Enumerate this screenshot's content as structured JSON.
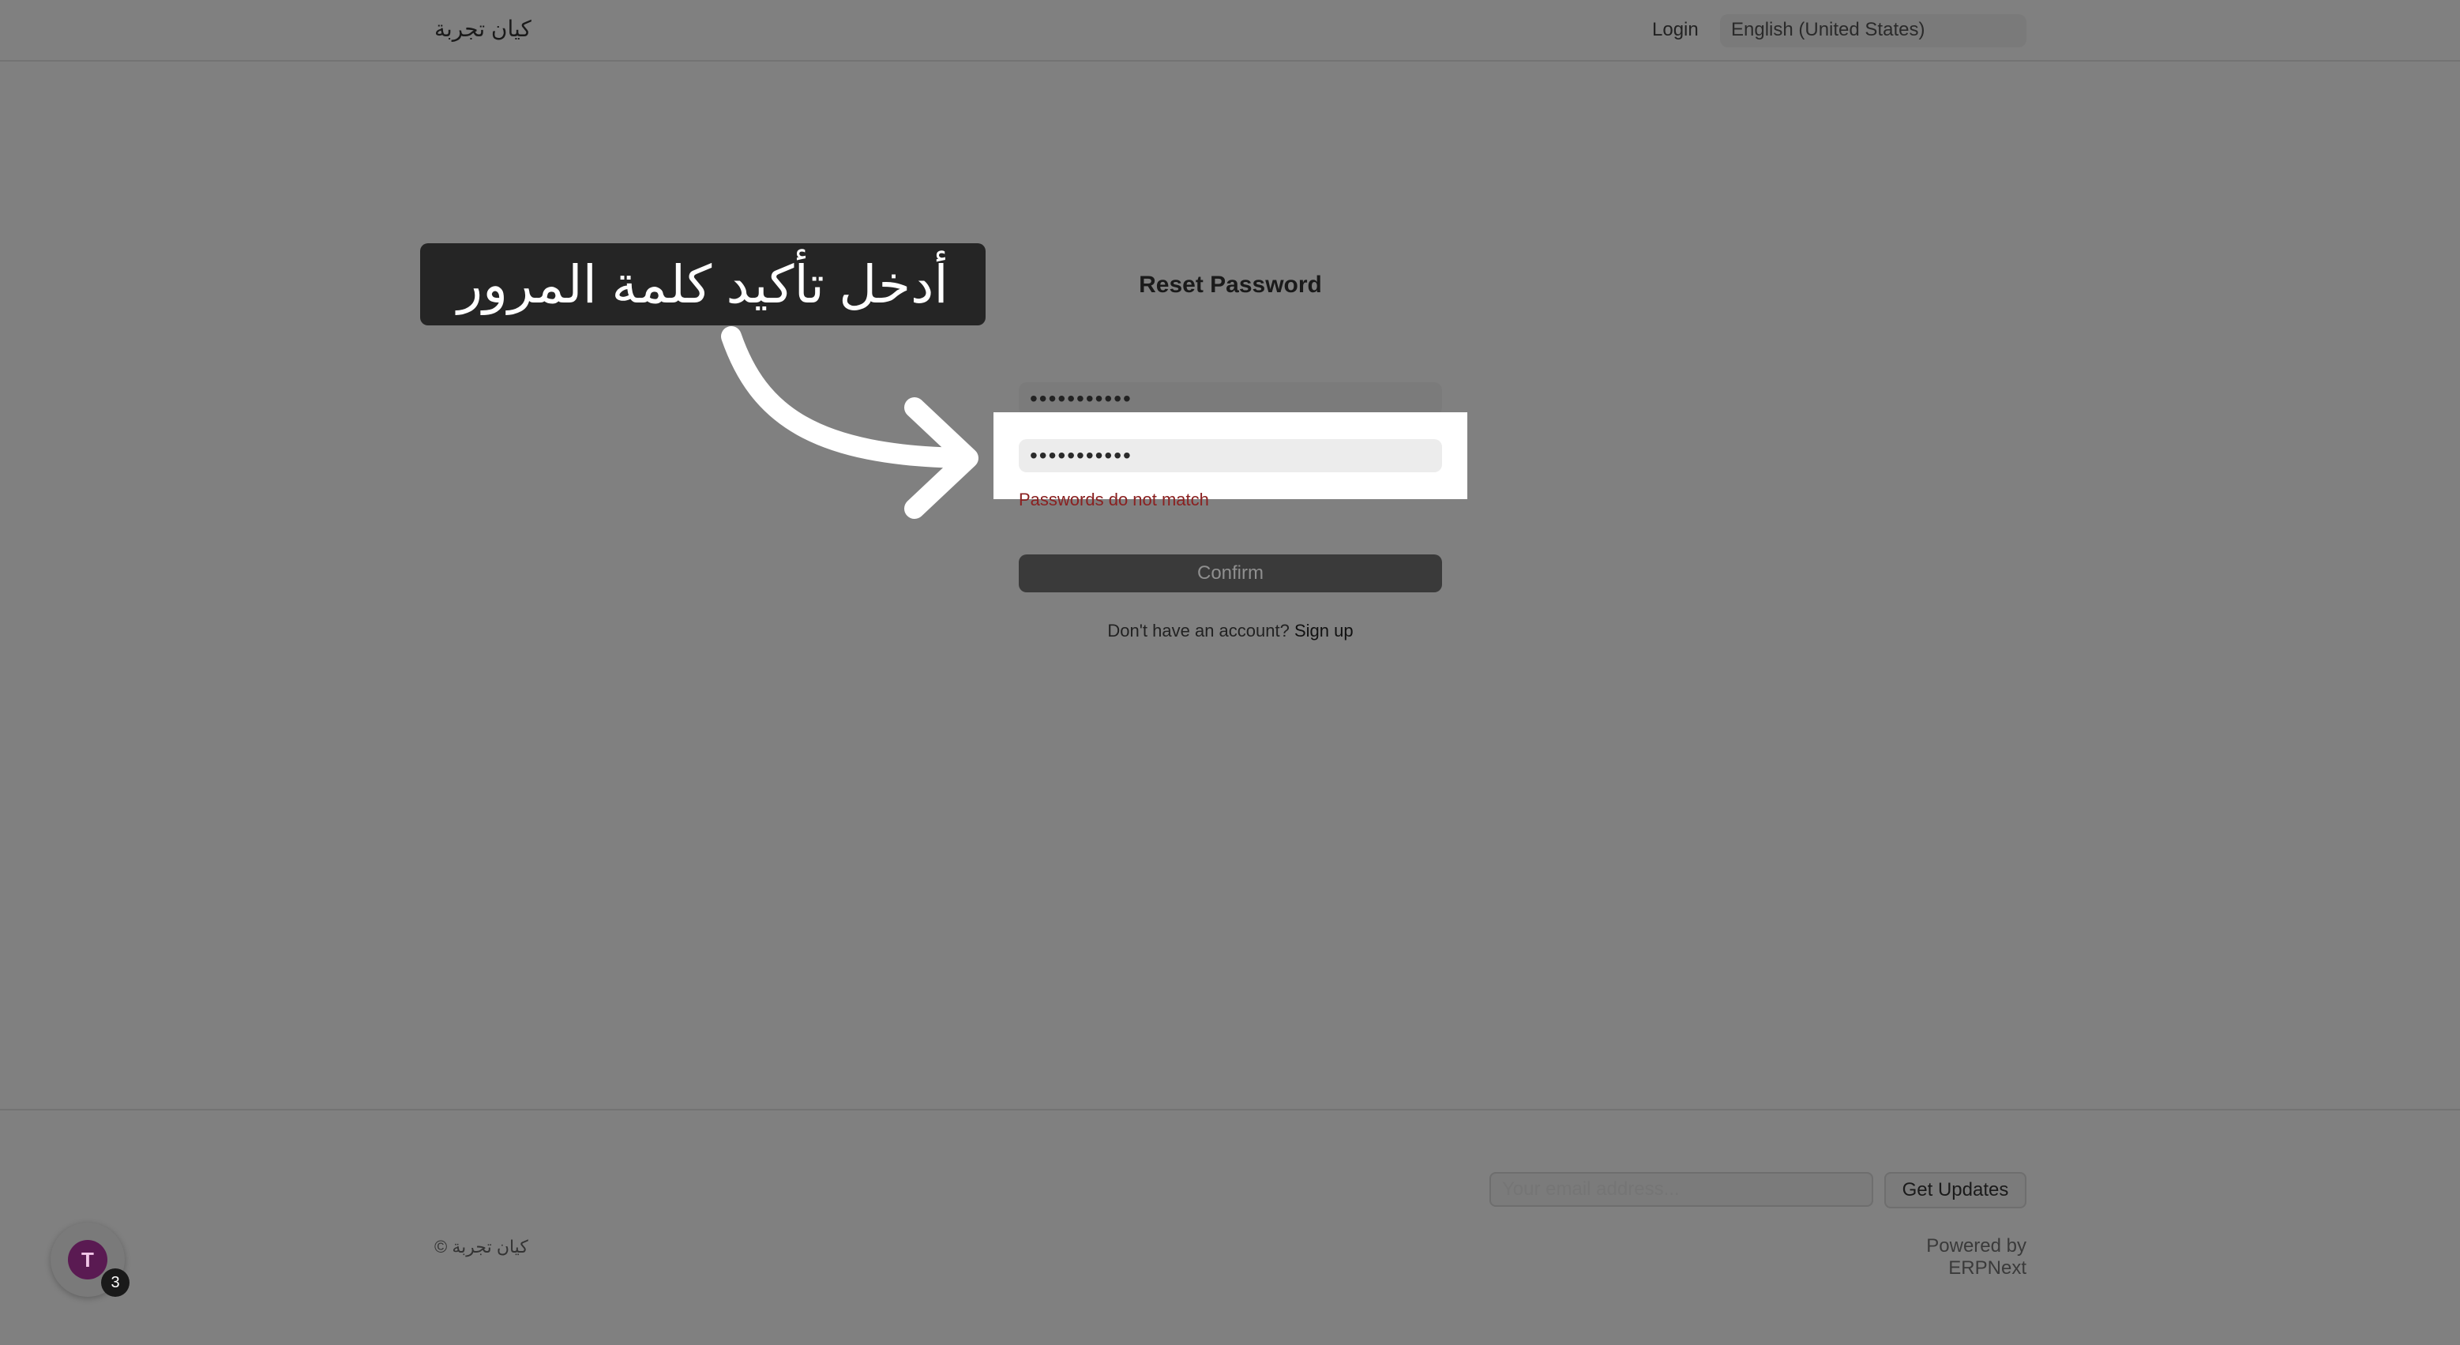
{
  "navbar": {
    "brand": "كيان تجربة",
    "login": "Login",
    "language": "English (United States)"
  },
  "form": {
    "title": "Reset Password",
    "new_password_value": "•••••••••••",
    "confirm_password_value": "•••••••••••",
    "error": "Passwords do not match",
    "confirm_label": "Confirm",
    "signup_prompt": "Don't have an account?",
    "signup_link": "Sign up"
  },
  "callout": {
    "text": "أدخل تأكيد كلمة المرور"
  },
  "footer": {
    "email_placeholder": "Your email address...",
    "updates_button": "Get Updates",
    "copyright": "© كيان تجربة",
    "powered_by": "Powered by ERPNext"
  },
  "widget": {
    "logo_letter": "T",
    "badge_count": "3"
  }
}
